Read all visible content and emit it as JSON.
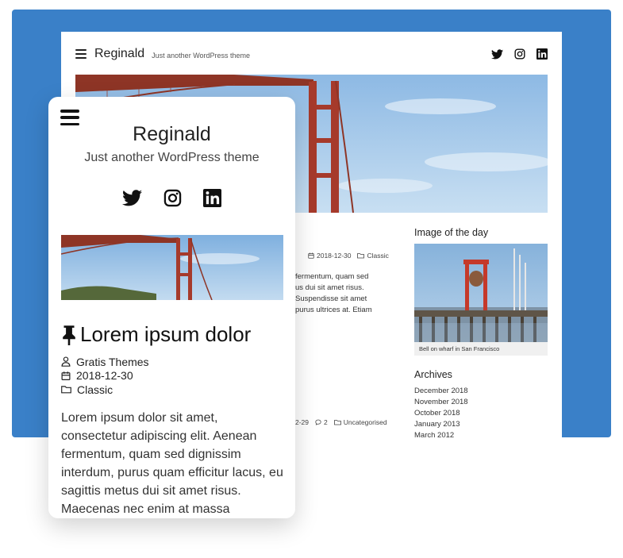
{
  "desktop": {
    "site_title": "Reginald",
    "tagline": "Just another WordPress theme",
    "post_date": "2018-12-30",
    "post_category": "Classic",
    "excerpt": "fermentum, quam sed\nus dui sit amet risus.\nSuspendisse sit amet\npurus ultrices at. Etiam",
    "second_post_date": "2-29",
    "second_post_comments": "2",
    "second_post_category": "Uncategorised",
    "sidebar": {
      "image_widget_title": "Image of the day",
      "image_caption": "Bell on wharf in San Francisco",
      "archives_title": "Archives",
      "archives": [
        "December 2018",
        "November 2018",
        "October 2018",
        "January 2013",
        "March 2012"
      ]
    }
  },
  "mobile": {
    "site_title": "Reginald",
    "tagline": "Just another WordPress theme",
    "post_title": "Lorem ipsum dolor",
    "author": "Gratis Themes",
    "date": "2018-12-30",
    "category": "Classic",
    "excerpt": "Lorem ipsum dolor sit amet, consectetur adipiscing elit. Aenean fermentum, quam sed dignissim interdum, purus quam efficitur lacus, eu sagittis metus dui sit amet risus. Maecenas nec enim at massa"
  },
  "icons": {
    "menu": "menu-icon",
    "twitter": "twitter-icon",
    "instagram": "instagram-icon",
    "linkedin": "linkedin-icon",
    "pin": "pin-icon",
    "user": "user-icon",
    "calendar": "calendar-icon",
    "folder": "folder-icon",
    "comment": "comment-icon"
  },
  "colors": {
    "backdrop": "#3a80c8",
    "bridge": "#b23a2a",
    "sky": "#9cc2e6"
  }
}
